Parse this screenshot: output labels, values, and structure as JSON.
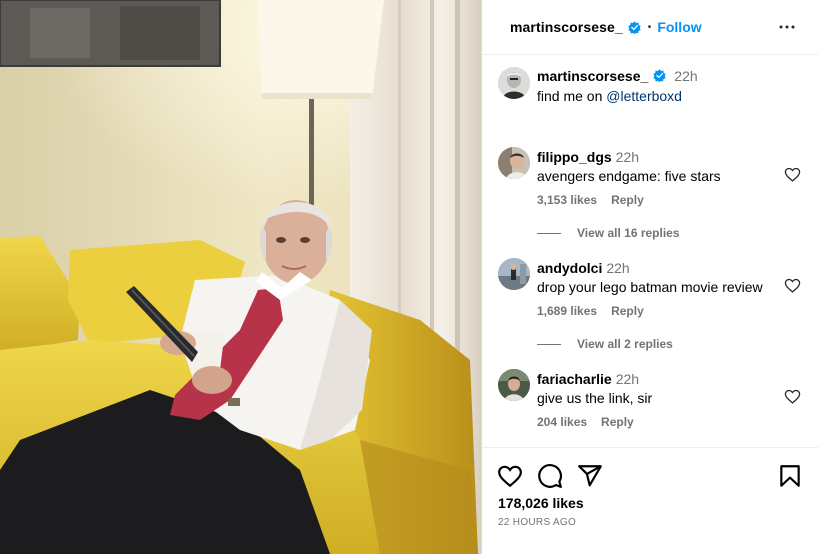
{
  "post": {
    "username": "martinscorsese_",
    "separator": "•",
    "follow_label": "Follow",
    "more_icon": "more-options-icon"
  },
  "caption": {
    "username": "martinscorsese_",
    "time": "22h",
    "text_prefix": "find me on ",
    "mention": "@letterboxd"
  },
  "comments": [
    {
      "username": "filippo_dgs",
      "time": "22h",
      "text": "avengers endgame: five stars",
      "likes": "3,153 likes",
      "reply": "Reply",
      "view_replies": "View all 16 replies"
    },
    {
      "username": "andydolci",
      "time": "22h",
      "text": "drop your lego batman movie review",
      "likes": "1,689 likes",
      "reply": "Reply",
      "view_replies": "View all 2 replies"
    },
    {
      "username": "fariacharlie",
      "time": "22h",
      "text": "give us the link, sir",
      "likes": "204 likes",
      "reply": "Reply"
    }
  ],
  "footer": {
    "likes": "178,026 likes",
    "time_ago": "22 HOURS AGO"
  },
  "colors": {
    "follow_blue": "#0095f6",
    "verified_blue": "#0095f6",
    "link": "#00376b",
    "secondary_text": "#737373"
  }
}
